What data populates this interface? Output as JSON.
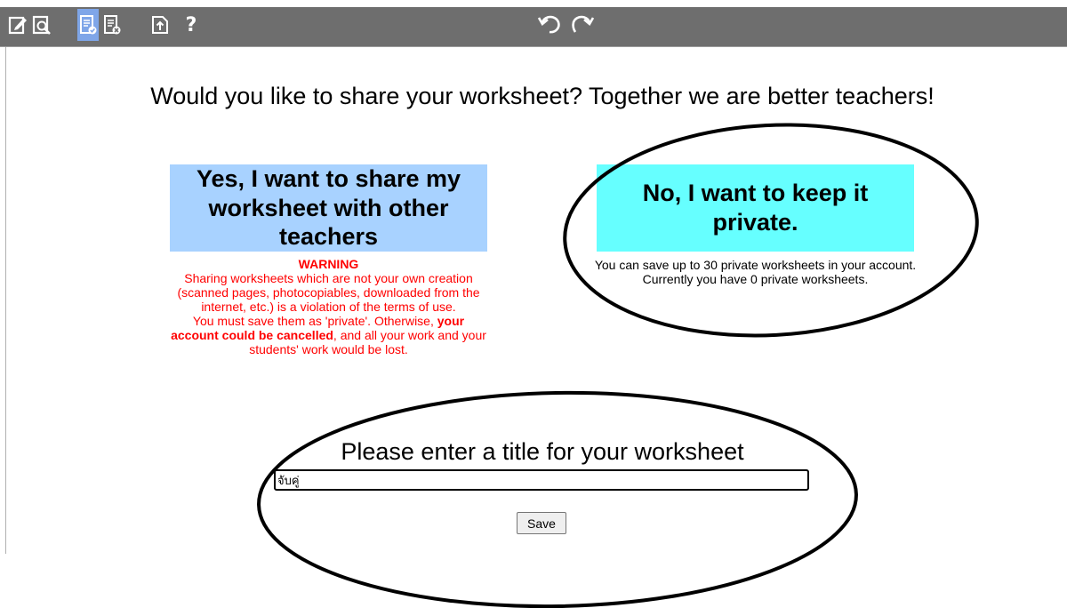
{
  "toolbar": {
    "tools": [
      {
        "icon": "edit-icon"
      },
      {
        "icon": "preview-icon"
      },
      {
        "icon": "save-worksheet-icon",
        "active": true
      },
      {
        "icon": "delete-worksheet-icon"
      },
      {
        "icon": "export-icon"
      }
    ],
    "help_label": "?",
    "colors": {
      "bar": "#6e6e6e",
      "active": "#7fa6e8"
    }
  },
  "headline": "Would you like to share your worksheet? Together we are better teachers!",
  "share_option": {
    "label": "Yes, I want to share my worksheet with other teachers",
    "color": "#a8d2ff"
  },
  "warning": {
    "title": "WARNING",
    "line1": "Sharing worksheets which are not your own creation (scanned pages, photocopiables, downloaded from the internet, etc.) is a violation of the terms of use.",
    "line2_start": "You must save them as 'private'. Otherwise, ",
    "line2_bold": "your account could be cancelled",
    "line2_end": ", and all your work and your students' work would be lost.",
    "color": "#ff0000"
  },
  "private_option": {
    "label": "No, I want to keep it private.",
    "color": "#66ffff",
    "info_line1": "You can save up to 30 private worksheets in your account.",
    "info_line2": "Currently you have 0 private worksheets."
  },
  "title_form": {
    "prompt": "Please enter a title for your worksheet",
    "value": "จับคู่",
    "save_label": "Save"
  }
}
